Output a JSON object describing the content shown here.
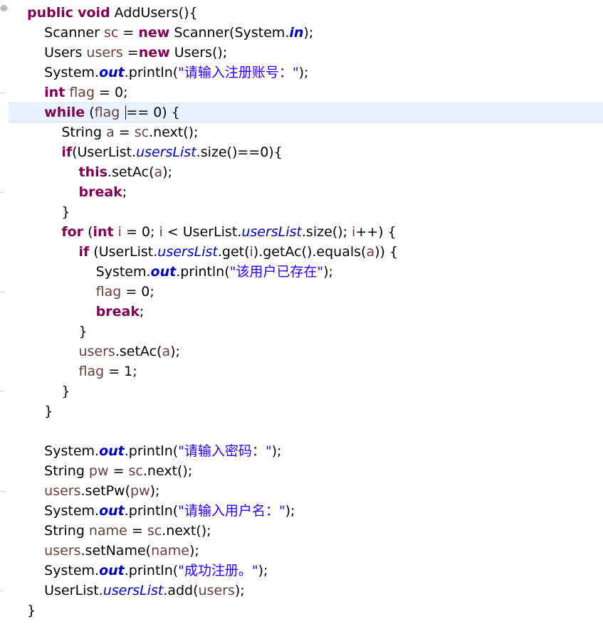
{
  "editor": {
    "fold_icon": "⊖",
    "indent": "    ",
    "lines": [
      {
        "indent": 0,
        "tokens": [
          {
            "t": "public",
            "c": "kw"
          },
          {
            "t": " "
          },
          {
            "t": "void",
            "c": "kw"
          },
          {
            "t": " AddUsers(){"
          }
        ]
      },
      {
        "indent": 1,
        "tokens": [
          {
            "t": "Scanner "
          },
          {
            "t": "sc",
            "c": "var"
          },
          {
            "t": " = "
          },
          {
            "t": "new",
            "c": "kw"
          },
          {
            "t": " Scanner(System."
          },
          {
            "t": "in",
            "c": "sfield"
          },
          {
            "t": ");"
          }
        ]
      },
      {
        "indent": 1,
        "tokens": [
          {
            "t": "Users "
          },
          {
            "t": "users",
            "c": "var"
          },
          {
            "t": " ="
          },
          {
            "t": "new",
            "c": "kw"
          },
          {
            "t": " Users();"
          }
        ]
      },
      {
        "indent": 1,
        "tokens": [
          {
            "t": "System."
          },
          {
            "t": "out",
            "c": "sfield"
          },
          {
            "t": ".println("
          },
          {
            "t": "\"请输入注册账号：\"",
            "c": "str"
          },
          {
            "t": ");"
          }
        ]
      },
      {
        "indent": 1,
        "tokens": [
          {
            "t": "int",
            "c": "kw"
          },
          {
            "t": " "
          },
          {
            "t": "flag",
            "c": "var"
          },
          {
            "t": " = 0;"
          }
        ]
      },
      {
        "indent": 1,
        "tokens": [
          {
            "t": "while",
            "c": "kw"
          },
          {
            "t": " ("
          },
          {
            "t": "flag",
            "c": "var"
          },
          {
            "t": " ",
            "caret": true
          },
          {
            "t": "== 0) {"
          }
        ]
      },
      {
        "indent": 2,
        "tokens": [
          {
            "t": "String "
          },
          {
            "t": "a",
            "c": "var"
          },
          {
            "t": " = "
          },
          {
            "t": "sc",
            "c": "var"
          },
          {
            "t": ".next();"
          }
        ]
      },
      {
        "indent": 2,
        "tokens": [
          {
            "t": "if",
            "c": "kw"
          },
          {
            "t": "(UserList."
          },
          {
            "t": "usersList",
            "c": "field"
          },
          {
            "t": ".size()==0){"
          }
        ]
      },
      {
        "indent": 3,
        "tokens": [
          {
            "t": "this",
            "c": "kw"
          },
          {
            "t": ".setAc("
          },
          {
            "t": "a",
            "c": "var"
          },
          {
            "t": ");"
          }
        ]
      },
      {
        "indent": 3,
        "tokens": [
          {
            "t": "break",
            "c": "kw"
          },
          {
            "t": ";"
          }
        ]
      },
      {
        "indent": 2,
        "tokens": [
          {
            "t": "}"
          }
        ]
      },
      {
        "indent": 2,
        "tokens": [
          {
            "t": "for",
            "c": "kw"
          },
          {
            "t": " ("
          },
          {
            "t": "int",
            "c": "kw"
          },
          {
            "t": " "
          },
          {
            "t": "i",
            "c": "var"
          },
          {
            "t": " = 0; "
          },
          {
            "t": "i",
            "c": "var"
          },
          {
            "t": " < UserList."
          },
          {
            "t": "usersList",
            "c": "field"
          },
          {
            "t": ".size(); "
          },
          {
            "t": "i",
            "c": "var"
          },
          {
            "t": "++) {"
          }
        ]
      },
      {
        "indent": 3,
        "tokens": [
          {
            "t": "if",
            "c": "kw"
          },
          {
            "t": " (UserList."
          },
          {
            "t": "usersList",
            "c": "field"
          },
          {
            "t": ".get("
          },
          {
            "t": "i",
            "c": "var"
          },
          {
            "t": ").getAc().equals("
          },
          {
            "t": "a",
            "c": "var"
          },
          {
            "t": ")) {"
          }
        ]
      },
      {
        "indent": 4,
        "tokens": [
          {
            "t": "System."
          },
          {
            "t": "out",
            "c": "sfield"
          },
          {
            "t": ".println("
          },
          {
            "t": "\"该用户已存在\"",
            "c": "str"
          },
          {
            "t": ");"
          }
        ]
      },
      {
        "indent": 4,
        "tokens": [
          {
            "t": "flag",
            "c": "var"
          },
          {
            "t": " = 0;"
          }
        ]
      },
      {
        "indent": 4,
        "tokens": [
          {
            "t": "break",
            "c": "kw"
          },
          {
            "t": ";"
          }
        ]
      },
      {
        "indent": 3,
        "tokens": [
          {
            "t": "}"
          }
        ]
      },
      {
        "indent": 3,
        "tokens": [
          {
            "t": "users",
            "c": "var"
          },
          {
            "t": ".setAc("
          },
          {
            "t": "a",
            "c": "var"
          },
          {
            "t": ");"
          }
        ]
      },
      {
        "indent": 3,
        "tokens": [
          {
            "t": "flag",
            "c": "var"
          },
          {
            "t": " = 1;"
          }
        ]
      },
      {
        "indent": 2,
        "tokens": [
          {
            "t": "}"
          }
        ]
      },
      {
        "indent": 1,
        "tokens": [
          {
            "t": "}"
          }
        ]
      },
      {
        "indent": 0,
        "tokens": []
      },
      {
        "indent": 1,
        "tokens": [
          {
            "t": "System."
          },
          {
            "t": "out",
            "c": "sfield"
          },
          {
            "t": ".println("
          },
          {
            "t": "\"请输入密码：\"",
            "c": "str"
          },
          {
            "t": ");"
          }
        ]
      },
      {
        "indent": 1,
        "tokens": [
          {
            "t": "String "
          },
          {
            "t": "pw",
            "c": "var"
          },
          {
            "t": " = "
          },
          {
            "t": "sc",
            "c": "var"
          },
          {
            "t": ".next();"
          }
        ]
      },
      {
        "indent": 1,
        "tokens": [
          {
            "t": "users",
            "c": "var"
          },
          {
            "t": ".setPw("
          },
          {
            "t": "pw",
            "c": "var"
          },
          {
            "t": ");"
          }
        ]
      },
      {
        "indent": 1,
        "tokens": [
          {
            "t": "System."
          },
          {
            "t": "out",
            "c": "sfield"
          },
          {
            "t": ".println("
          },
          {
            "t": "\"请输入用户名：\"",
            "c": "str"
          },
          {
            "t": ");"
          }
        ]
      },
      {
        "indent": 1,
        "tokens": [
          {
            "t": "String "
          },
          {
            "t": "name",
            "c": "var"
          },
          {
            "t": " = "
          },
          {
            "t": "sc",
            "c": "var"
          },
          {
            "t": ".next();"
          }
        ]
      },
      {
        "indent": 1,
        "tokens": [
          {
            "t": "users",
            "c": "var"
          },
          {
            "t": ".setName("
          },
          {
            "t": "name",
            "c": "var"
          },
          {
            "t": ");"
          }
        ]
      },
      {
        "indent": 1,
        "tokens": [
          {
            "t": "System."
          },
          {
            "t": "out",
            "c": "sfield"
          },
          {
            "t": ".println("
          },
          {
            "t": "\"成功注册。\"",
            "c": "str"
          },
          {
            "t": ");"
          }
        ]
      },
      {
        "indent": 1,
        "tokens": [
          {
            "t": "UserList."
          },
          {
            "t": "usersList",
            "c": "field"
          },
          {
            "t": ".add("
          },
          {
            "t": "users",
            "c": "var"
          },
          {
            "t": ");"
          }
        ]
      },
      {
        "indent": 0,
        "tokens": [
          {
            "t": "}"
          }
        ]
      }
    ],
    "colors": {
      "keyword": "#7f0055",
      "local_variable": "#6a3e3e",
      "field": "#0000c0",
      "string": "#2a00ff",
      "current_line_highlight": "#e8f2fe"
    }
  }
}
